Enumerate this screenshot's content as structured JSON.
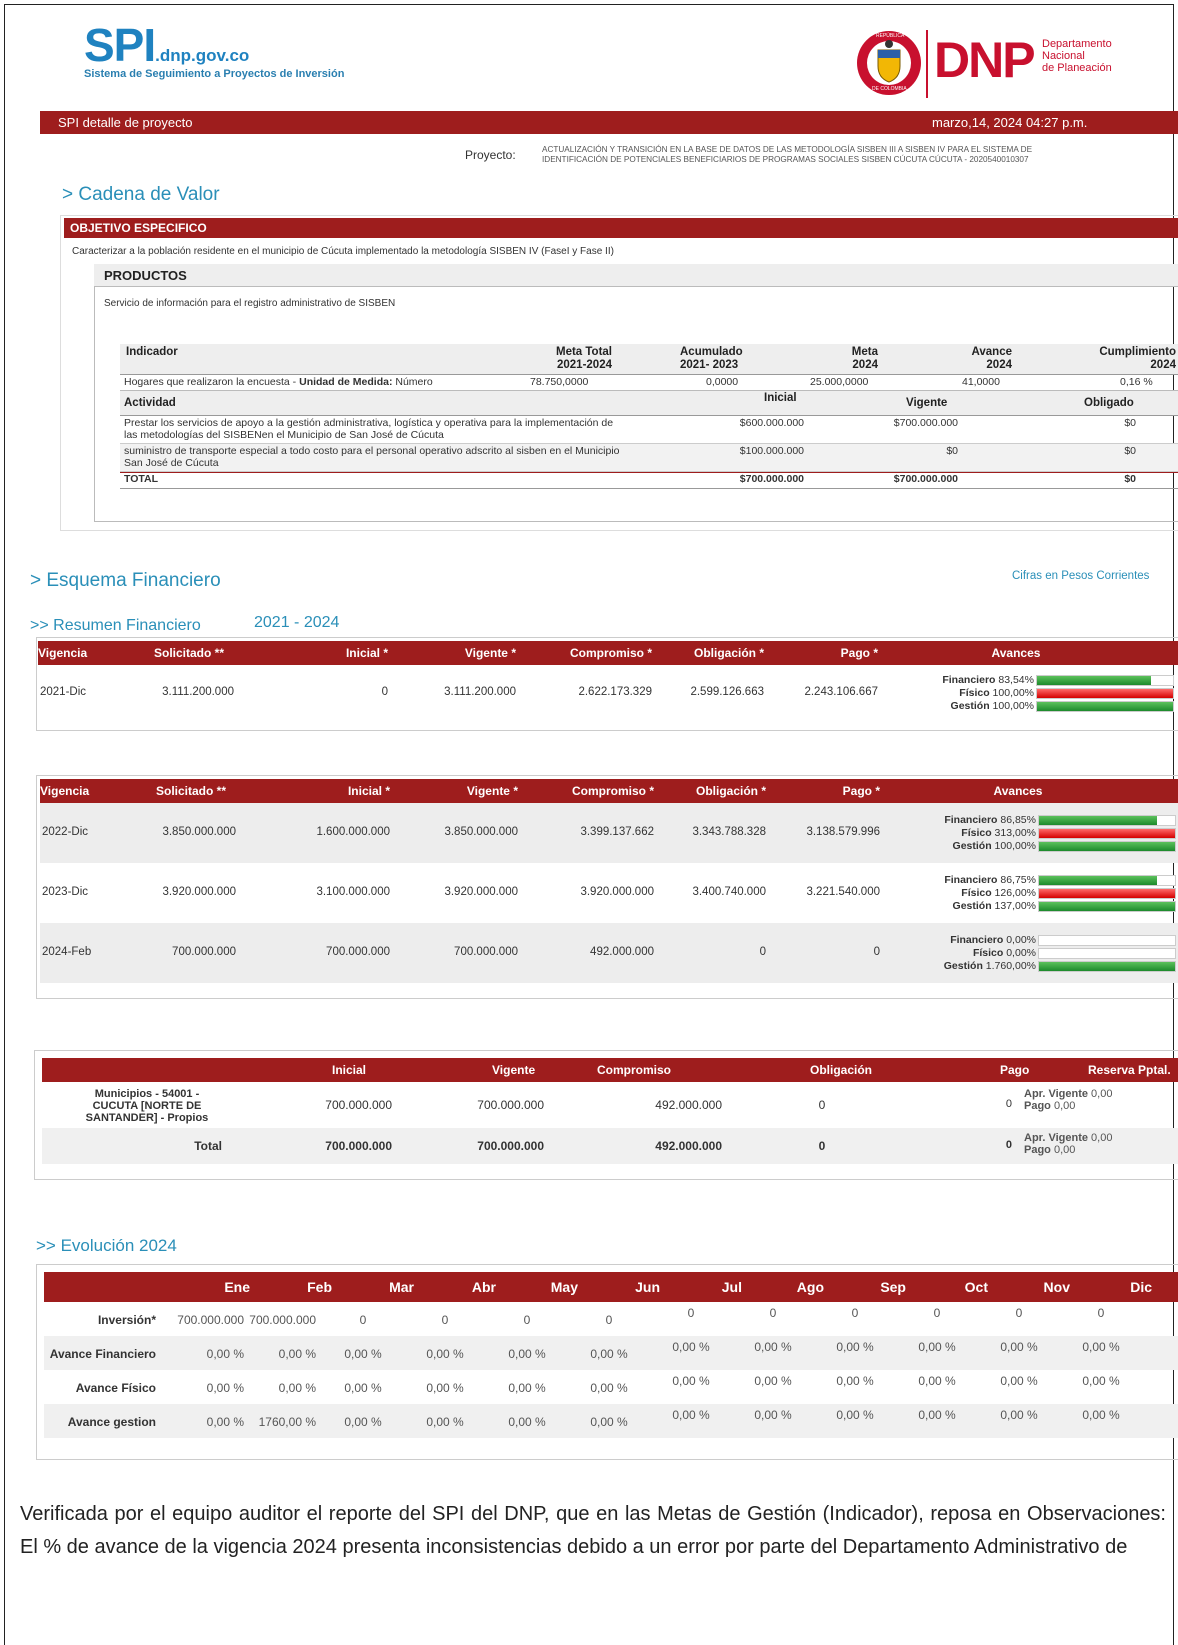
{
  "header": {
    "spi_logo": "SPI",
    "spi_domain": ".dnp.gov.co",
    "spi_subtitle": "Sistema de Seguimiento a Proyectos de Inversión",
    "dnp_logo": "DNP",
    "dnp_line1": "Departamento",
    "dnp_line2": "Nacional",
    "dnp_line3": "de Planeación",
    "seal_top": "REPÚBLICA",
    "seal_bottom": "DE COLOMBIA"
  },
  "titlebar": {
    "left": "SPI detalle de proyecto",
    "right": "marzo,14,  2024 04:27 p.m."
  },
  "project": {
    "label": "Proyecto:",
    "line1": "ACTUALIZACIÓN Y TRANSICIÓN EN LA BASE DE DATOS DE LAS METODOLOGÍA SISBEN III A SISBEN IV PARA EL SISTEMA DE",
    "line2": "IDENTIFICACIÓN DE POTENCIALES BENEFICIARIOS DE PROGRAMAS SOCIALES SISBEN CÚCUTA  CÚCUTA - 2020540010307"
  },
  "cadena": {
    "title": "> Cadena de Valor",
    "objective_header": "OBJETIVO ESPECIFICO",
    "objective_text": "Caracterizar a la población residente en el municipio de Cúcuta implementado la metodología SISBEN IV (FaseI y Fase II)",
    "products_header": "PRODUCTOS",
    "product_text": "Servicio de información para el registro administrativo de SISBEN",
    "indicator_cols": [
      "Indicador",
      "Meta Total\n2021-2024",
      "Acumulado\n2021- 2023",
      "Meta\n2024",
      "Avance\n2024",
      "Cumplimiento\n2024"
    ],
    "indicator_row": {
      "name": "Hogares que realizaron la encuesta - ",
      "unit_label": "Unidad de Medida:",
      "unit": " Número",
      "meta_total": "78.750,0000",
      "acumulado": "0,0000",
      "meta": "25.000,0000",
      "avance": "41,0000",
      "cumplimiento": "0,16 %"
    },
    "activity_cols": [
      "Actividad",
      "Inicial",
      "Vigente",
      "Obligado"
    ],
    "activities": [
      {
        "name": "Prestar los servicios de apoyo a la gestión administrativa, logística y operativa para la implementación de las metodologías del SISBENen el Municipio de San José de Cúcuta",
        "inicial": "$600.000.000",
        "vigente": "$700.000.000",
        "obligado": "$0"
      },
      {
        "name": "suministro de transporte especial a todo costo para el personal operativo adscrito al sisben en el Municipio San José de Cúcuta",
        "inicial": "$100.000.000",
        "vigente": "$0",
        "obligado": "$0"
      }
    ],
    "total": {
      "name": "TOTAL",
      "inicial": "$700.000.000",
      "vigente": "$700.000.000",
      "obligado": "$0"
    }
  },
  "esquema": {
    "title": "> Esquema Financiero",
    "cifras": "Cifras en Pesos Corrientes",
    "resumen_title": ">> Resumen Financiero",
    "resumen_years": "2021 - 2024",
    "cols": [
      "Vigencia",
      "Solicitado **",
      "Inicial *",
      "Vigente *",
      "Compromiso *",
      "Obligación *",
      "Pago *",
      "Avances"
    ],
    "labels": {
      "fin": "Financiero",
      "fis": "Físico",
      "ges": "Gestión"
    },
    "rows": [
      {
        "vigencia": "2021-Dic",
        "solicitado": "3.111.200.000",
        "inicial": "0",
        "vigente": "3.111.200.000",
        "compromiso": "2.622.173.329",
        "obligacion": "2.599.126.663",
        "pago": "2.243.106.667",
        "fin": "83,54%",
        "fis": "100,00%",
        "ges": "100,00%",
        "fin_v": 0.8354,
        "fis_v": 1,
        "ges_v": 1
      },
      {
        "vigencia": "2022-Dic",
        "solicitado": "3.850.000.000",
        "inicial": "1.600.000.000",
        "vigente": "3.850.000.000",
        "compromiso": "3.399.137.662",
        "obligacion": "3.343.788.328",
        "pago": "3.138.579.996",
        "fin": "86,85%",
        "fis": "313,00%",
        "ges": "100,00%",
        "fin_v": 0.8685,
        "fis_v": 1,
        "ges_v": 1
      },
      {
        "vigencia": "2023-Dic",
        "solicitado": "3.920.000.000",
        "inicial": "3.100.000.000",
        "vigente": "3.920.000.000",
        "compromiso": "3.920.000.000",
        "obligacion": "3.400.740.000",
        "pago": "3.221.540.000",
        "fin": "86,75%",
        "fis": "126,00%",
        "ges": "137,00%",
        "fin_v": 0.8675,
        "fis_v": 1,
        "ges_v": 1
      },
      {
        "vigencia": "2024-Feb",
        "solicitado": "700.000.000",
        "inicial": "700.000.000",
        "vigente": "700.000.000",
        "compromiso": "492.000.000",
        "obligacion": "0",
        "pago": "0",
        "fin": "0,00%",
        "fis": "0,00%",
        "ges": "1.760,00%",
        "fin_v": 0,
        "fis_v": 0,
        "ges_v": 1
      }
    ]
  },
  "fuentes": {
    "cols": [
      "",
      "Inicial",
      "Vigente",
      "Compromiso",
      "Obligación",
      "Pago",
      "Reserva Pptal."
    ],
    "row": {
      "name": "Municipios - 54001 - CUCUTA [NORTE DE SANTANDER]  - Propios",
      "inicial": "700.000.000",
      "vigente": "700.000.000",
      "compromiso": "492.000.000",
      "obligacion": "0",
      "pago": "0"
    },
    "total": {
      "name": "Total",
      "inicial": "700.000.000",
      "vigente": "700.000.000",
      "compromiso": "492.000.000",
      "obligacion": "0",
      "pago": "0"
    },
    "reserva": {
      "apr_label": "Apr. Vigente",
      "apr": " 0,00",
      "pago_label": "Pago",
      "pago": " 0,00"
    }
  },
  "evolucion": {
    "title": ">> Evolución 2024",
    "months": [
      "Ene",
      "Feb",
      "Mar",
      "Abr",
      "May",
      "Jun",
      "Jul",
      "Ago",
      "Sep",
      "Oct",
      "Nov",
      "Dic"
    ],
    "rows": [
      {
        "label": "Inversión*",
        "values": [
          "700.000.000",
          "700.000.000",
          "0",
          "0",
          "0",
          "0",
          "0",
          "0",
          "0",
          "0",
          "0",
          "0"
        ]
      },
      {
        "label": "Avance Financiero",
        "values": [
          "0,00 %",
          "0,00 %",
          "0,00 %",
          "0,00 %",
          "0,00 %",
          "0,00 %",
          "0,00 %",
          "0,00 %",
          "0,00 %",
          "0,00 %",
          "0,00 %",
          "0,00 %"
        ]
      },
      {
        "label": "Avance Físico",
        "values": [
          "0,00 %",
          "0,00 %",
          "0,00 %",
          "0,00 %",
          "0,00 %",
          "0,00 %",
          "0,00 %",
          "0,00 %",
          "0,00 %",
          "0,00 %",
          "0,00 %",
          "0,00 %"
        ]
      },
      {
        "label": "Avance gestion",
        "values": [
          "0,00 %",
          "1760,00 %",
          "0,00 %",
          "0,00 %",
          "0,00 %",
          "0,00 %",
          "0,00 %",
          "0,00 %",
          "0,00 %",
          "0,00 %",
          "0,00 %",
          "0,00 %"
        ]
      }
    ]
  },
  "paragraph": "Verificada por el equipo auditor el reporte del SPI del DNP, que en las Metas de Gestión (Indicador), reposa en Observaciones: El % de avance de la vigencia 2024 presenta inconsistencias debido a un error por parte del Departamento Administrativo de"
}
